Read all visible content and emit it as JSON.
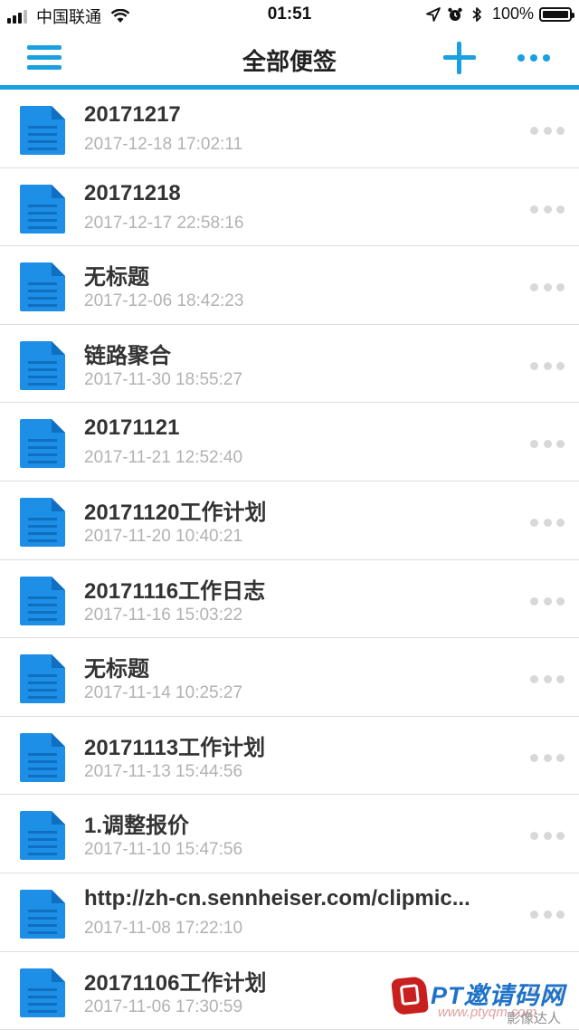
{
  "status_bar": {
    "carrier": "中国联通",
    "time": "01:51",
    "battery": "100%"
  },
  "nav": {
    "title": "全部便签",
    "menu_icon": "hamburger-menu-icon",
    "add_icon": "plus-icon",
    "more_icon": "more-dots-icon"
  },
  "colors": {
    "accent": "#1aa0e0",
    "doc_icon": "#1e8fe6",
    "title_text": "#333333",
    "date_text": "#b2b2b2",
    "divider": "#dedede"
  },
  "notes": [
    {
      "title": "20171217",
      "date": "2017-12-18 17:02:11"
    },
    {
      "title": "20171218",
      "date": "2017-12-17 22:58:16"
    },
    {
      "title": "无标题",
      "date": "2017-12-06 18:42:23"
    },
    {
      "title": "链路聚合",
      "date": "2017-11-30 18:55:27"
    },
    {
      "title": "20171121",
      "date": "2017-11-21 12:52:40"
    },
    {
      "title": "20171120工作计划",
      "date": "2017-11-20 10:40:21"
    },
    {
      "title": "20171116工作日志",
      "date": "2017-11-16 15:03:22"
    },
    {
      "title": "无标题",
      "date": "2017-11-14 10:25:27"
    },
    {
      "title": "20171113工作计划",
      "date": "2017-11-13 15:44:56"
    },
    {
      "title": "1.调整报价",
      "date": "2017-11-10 15:47:56"
    },
    {
      "title": "http://zh-cn.sennheiser.com/clipmic...",
      "date": "2017-11-08 17:22:10"
    },
    {
      "title": "20171106工作计划",
      "date": "2017-11-06 17:30:59"
    }
  ],
  "watermark": {
    "logo": "PT邀请码网",
    "url": "www.ptyqm.com",
    "sub": "影像达人"
  }
}
